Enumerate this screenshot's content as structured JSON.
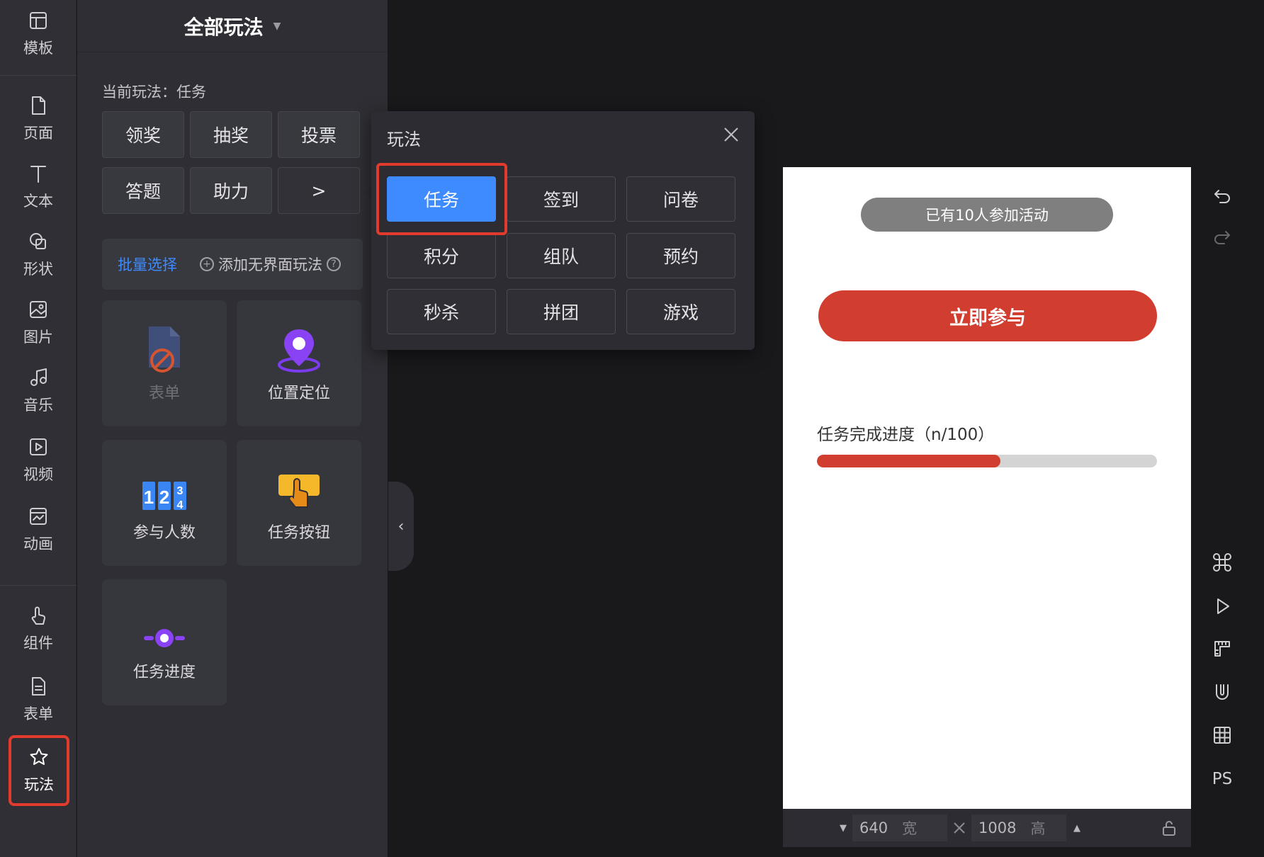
{
  "nav": {
    "items": [
      {
        "label": "模板",
        "icon": "template-icon"
      },
      {
        "label": "页面",
        "icon": "page-icon"
      },
      {
        "label": "文本",
        "icon": "text-icon"
      },
      {
        "label": "形状",
        "icon": "shape-icon"
      },
      {
        "label": "图片",
        "icon": "image-icon"
      },
      {
        "label": "音乐",
        "icon": "music-icon"
      },
      {
        "label": "视频",
        "icon": "video-icon"
      },
      {
        "label": "动画",
        "icon": "animation-icon"
      },
      {
        "label": "组件",
        "icon": "component-icon"
      },
      {
        "label": "表单",
        "icon": "form-icon"
      },
      {
        "label": "玩法",
        "icon": "gameplay-icon",
        "active": true
      }
    ]
  },
  "panel": {
    "title": "全部玩法",
    "current_label": "当前玩法：任务",
    "categories": [
      "领奖",
      "抽奖",
      "投票",
      "答题",
      "助力"
    ],
    "more": ">",
    "batch_select": "批量选择",
    "add_headless": "添加无界面玩法",
    "cards": [
      {
        "label": "表单",
        "icon": "form-disabled-icon",
        "disabled": true
      },
      {
        "label": "位置定位",
        "icon": "location-pin-icon"
      },
      {
        "label": "参与人数",
        "icon": "counter-icon",
        "digits": [
          "1",
          "2",
          "3",
          "4"
        ]
      },
      {
        "label": "任务按钮",
        "icon": "task-button-icon"
      },
      {
        "label": "任务进度",
        "icon": "task-progress-icon"
      }
    ]
  },
  "popover": {
    "title": "玩法",
    "options": [
      "任务",
      "签到",
      "问卷",
      "积分",
      "组队",
      "预约",
      "秒杀",
      "拼团",
      "游戏"
    ],
    "selected": "任务"
  },
  "canvas": {
    "badge": "已有10人参加活动",
    "join_button": "立即参与",
    "progress_label": "任务完成进度（n/100）",
    "progress_fraction": 0.54,
    "accent": "#d13e2f"
  },
  "sizebar": {
    "width": "640",
    "width_unit": "宽",
    "height": "1008",
    "height_unit": "高"
  },
  "right_toolbar": {
    "ps_label": "PS"
  }
}
